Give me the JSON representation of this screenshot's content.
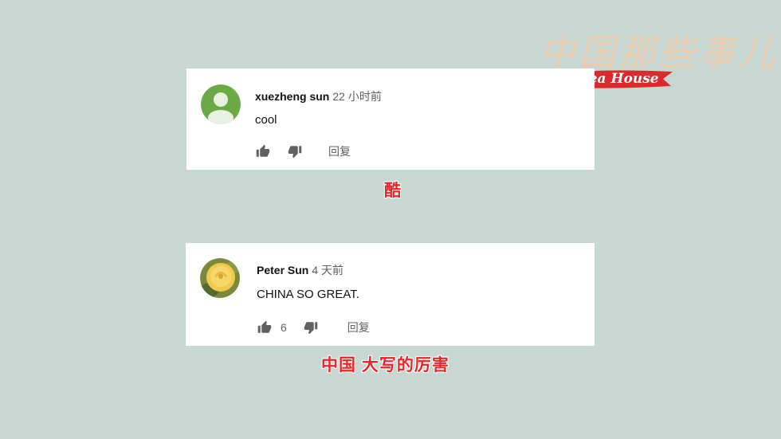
{
  "logo": {
    "chinese_text": "中国那些事儿",
    "english_text": "Tea House"
  },
  "comments": [
    {
      "author": "xuezheng sun",
      "time": "22 小时前",
      "text": "cool",
      "likes": "",
      "reply_label": "回复",
      "avatar": "default-person-avatar",
      "avatar_color": "#6aaa44"
    },
    {
      "author": "Peter Sun",
      "time": "4 天前",
      "text": "CHINA SO GREAT.",
      "likes": "6",
      "reply_label": "回复",
      "avatar": "yellow-rose-avatar"
    }
  ],
  "subtitles": [
    "酷",
    "中国 大写的厉害"
  ],
  "colors": {
    "background": "#c7d8d3",
    "subtitle": "#e8262a",
    "ribbon": "#d92b2b"
  },
  "icons": [
    "thumb-up-icon",
    "thumb-down-icon"
  ]
}
